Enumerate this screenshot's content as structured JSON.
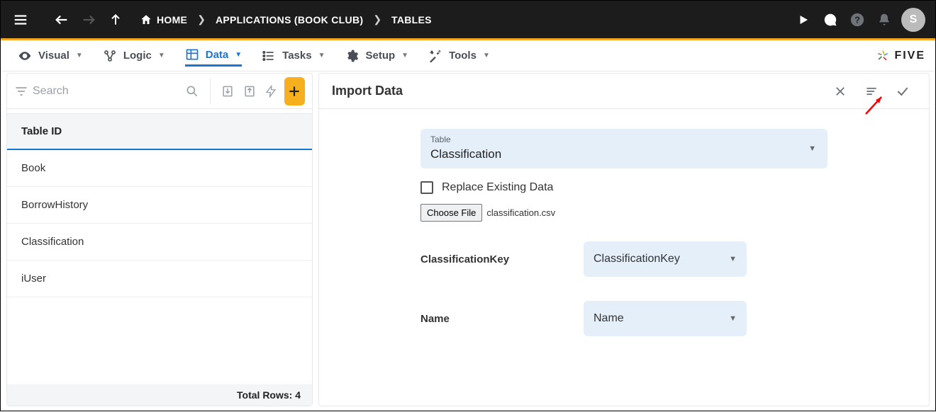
{
  "topbar": {
    "home_label": "HOME",
    "crumb_app": "APPLICATIONS (BOOK CLUB)",
    "crumb_tables": "TABLES",
    "avatar_initial": "S"
  },
  "navtabs": {
    "visual": "Visual",
    "logic": "Logic",
    "data": "Data",
    "tasks": "Tasks",
    "setup": "Setup",
    "tools": "Tools",
    "brand": "FIVE"
  },
  "left_panel": {
    "search_placeholder": "Search",
    "column_header": "Table ID",
    "rows": [
      "Book",
      "BorrowHistory",
      "Classification",
      "iUser"
    ],
    "footer_label": "Total Rows: 4"
  },
  "right_panel": {
    "title": "Import Data",
    "table_select": {
      "label": "Table",
      "value": "Classification"
    },
    "replace_label": "Replace Existing Data",
    "choose_file_label": "Choose File",
    "file_name": "classification.csv",
    "mappings": [
      {
        "field": "ClassificationKey",
        "value": "ClassificationKey"
      },
      {
        "field": "Name",
        "value": "Name"
      }
    ]
  }
}
